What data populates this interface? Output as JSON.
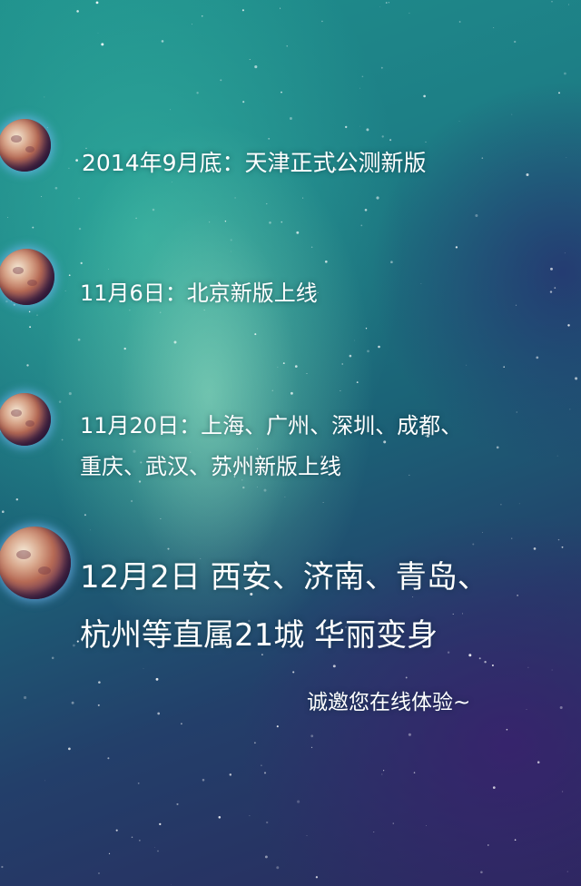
{
  "timeline": [
    {
      "lines": [
        "2014年9月底：天津正式公测新版"
      ]
    },
    {
      "lines": [
        "11月6日：北京新版上线"
      ]
    },
    {
      "lines": [
        "11月20日：上海、广州、深圳、成都、",
        "重庆、武汉、苏州新版上线"
      ]
    },
    {
      "lines": [
        "12月2日  西安、济南、青岛、",
        "杭州等直属21城 华丽变身"
      ]
    }
  ],
  "invitation": "诚邀您在线体验~",
  "icons": [
    "planet-icon"
  ],
  "colors": {
    "background_top": "#1f8f8c",
    "background_bottom": "#2a2a5e",
    "text": "#ffffff"
  }
}
